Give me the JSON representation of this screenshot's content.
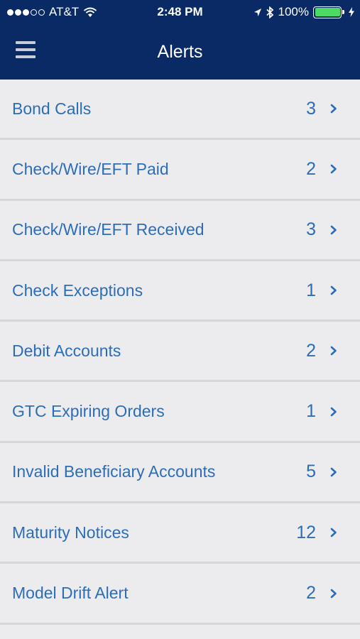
{
  "status_bar": {
    "carrier": "AT&T",
    "time": "2:48 PM",
    "battery_percent": "100%",
    "battery_level": 1.0,
    "signal_bars_filled": 3,
    "signal_bars_total": 5,
    "icons": [
      "wifi-icon",
      "location-icon",
      "bluetooth-icon",
      "battery-icon",
      "charging-icon"
    ]
  },
  "header": {
    "title": "Alerts",
    "menu_icon": "hamburger-menu-icon"
  },
  "colors": {
    "nav_background": "#0a2a66",
    "list_background": "#ececee",
    "row_text": "#2c6db8",
    "divider": "#d6d6da",
    "battery_fill": "#4cd964"
  },
  "alerts": [
    {
      "label": "Bond Calls",
      "count": "3"
    },
    {
      "label": "Check/Wire/EFT Paid",
      "count": "2"
    },
    {
      "label": "Check/Wire/EFT Received",
      "count": "3"
    },
    {
      "label": "Check Exceptions",
      "count": "1"
    },
    {
      "label": "Debit Accounts",
      "count": "2"
    },
    {
      "label": "GTC Expiring Orders",
      "count": "1"
    },
    {
      "label": "Invalid Beneficiary Accounts",
      "count": "5"
    },
    {
      "label": "Maturity Notices",
      "count": "12"
    },
    {
      "label": "Model Drift Alert",
      "count": "2"
    }
  ]
}
